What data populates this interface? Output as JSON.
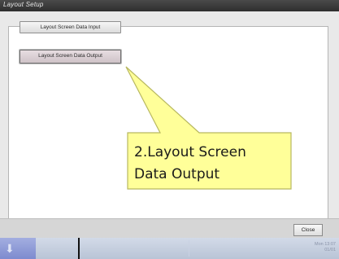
{
  "window": {
    "title": "Layout Setup"
  },
  "buttons": {
    "input_label": "Layout Screen Data Input",
    "output_label": "Layout Screen Data Output",
    "close_label": "Close"
  },
  "callout": {
    "line1": "2.Layout Screen",
    "line2": "Data Output",
    "fill_color": "#ffff99",
    "border_color": "#b8b860"
  },
  "taskbar": {
    "clock_line1": "Mon 13:07",
    "clock_line2": "01/01",
    "start_icon": "start-arrow-icon"
  }
}
